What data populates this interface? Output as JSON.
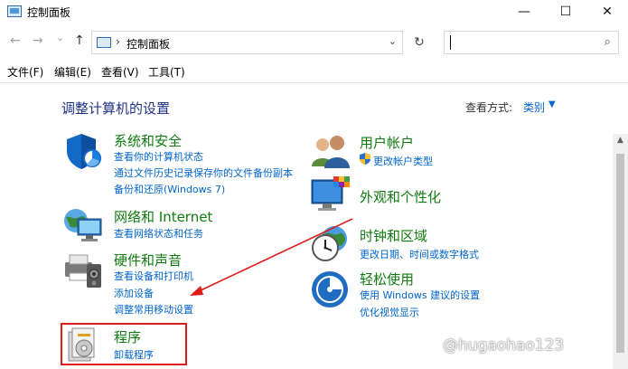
{
  "window": {
    "title": "控制面板",
    "minimize": "—",
    "maximize": "☐",
    "close": "✕"
  },
  "nav": {
    "back": "←",
    "forward": "→",
    "recent": "⌄",
    "up": "↑",
    "address_chevron": "›",
    "address": "控制面板",
    "address_dropdown": "⌄",
    "refresh": "↻",
    "search_icon": "⌕",
    "search_value": ""
  },
  "menu": {
    "file": "文件(F)",
    "edit": "编辑(E)",
    "view": "查看(V)",
    "tools": "工具(T)"
  },
  "content": {
    "title": "调整计算机的设置",
    "view_by_label": "查看方式:",
    "view_by_value": "类别",
    "view_by_arrow": "▼"
  },
  "categories": {
    "system": {
      "title": "系统和安全",
      "links": [
        "查看你的计算机状态",
        "通过文件历史记录保存你的文件备份副本",
        "备份和还原(Windows 7)"
      ]
    },
    "network": {
      "title": "网络和 Internet",
      "links": [
        "查看网络状态和任务"
      ]
    },
    "hardware": {
      "title": "硬件和声音",
      "links": [
        "查看设备和打印机",
        "添加设备",
        "调整常用移动设置"
      ]
    },
    "programs": {
      "title": "程序",
      "links": [
        "卸载程序"
      ]
    },
    "users": {
      "title": "用户帐户",
      "links": [
        "更改帐户类型"
      ]
    },
    "appearance": {
      "title": "外观和个性化",
      "links": []
    },
    "clock": {
      "title": "时钟和区域",
      "links": [
        "更改日期、时间或数字格式"
      ]
    },
    "ease": {
      "title": "轻松使用",
      "links": [
        "使用 Windows 建议的设置",
        "优化视觉显示"
      ]
    }
  },
  "scrollbar": {
    "up": "▲"
  },
  "watermark": "@hugaohao123",
  "colors": {
    "category_green": "#0f7b0f",
    "link_blue": "#0066cc",
    "title_blue": "#1e3287",
    "annotation_red": "#e01b1b"
  }
}
